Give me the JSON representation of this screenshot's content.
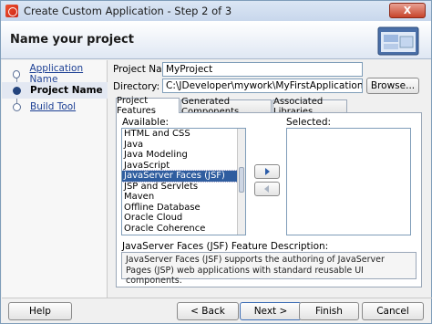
{
  "window": {
    "title": "Create Custom Application - Step 2 of 3",
    "close_label": "X"
  },
  "header": {
    "title": "Name your project",
    "graphic_icon": "wizard-window-icon"
  },
  "steps": [
    {
      "label": "Application Name",
      "state": "visited"
    },
    {
      "label": "Project Name",
      "state": "current"
    },
    {
      "label": "Build Tool",
      "state": "pending"
    }
  ],
  "form": {
    "project_name_label": "Project Name:",
    "project_name_value": "MyProject",
    "directory_label": "Directory:",
    "directory_value": "C:\\JDeveloper\\mywork\\MyFirstApplication\\MyProject",
    "browse_label": "Browse..."
  },
  "tabs": [
    {
      "label": "Project Features",
      "selected": true
    },
    {
      "label": "Generated Components",
      "selected": false
    },
    {
      "label": "Associated Libraries",
      "selected": false
    }
  ],
  "features": {
    "available_label": "Available:",
    "selected_label": "Selected:",
    "available_items": [
      "HTML and CSS",
      "Java",
      "Java Modeling",
      "JavaScript",
      "JavaServer Faces (JSF)",
      "JSP and Servlets",
      "Maven",
      "Offline Database",
      "Oracle Cloud",
      "Oracle Coherence"
    ],
    "selected_index": 4,
    "add_icon": "arrow-right-icon",
    "remove_icon": "arrow-left-icon",
    "description_label": "JavaServer Faces (JSF) Feature Description:",
    "description_text": "JavaServer Faces (JSF) supports the authoring of JavaServer Pages (JSP) web applications with standard reusable UI components."
  },
  "buttons": {
    "help": "Help",
    "back": "< Back",
    "next": "Next >",
    "finish": "Finish",
    "cancel": "Cancel"
  },
  "colors": {
    "selection": "#2f5d9f",
    "link": "#1c3f94",
    "close": "#c7432a"
  }
}
